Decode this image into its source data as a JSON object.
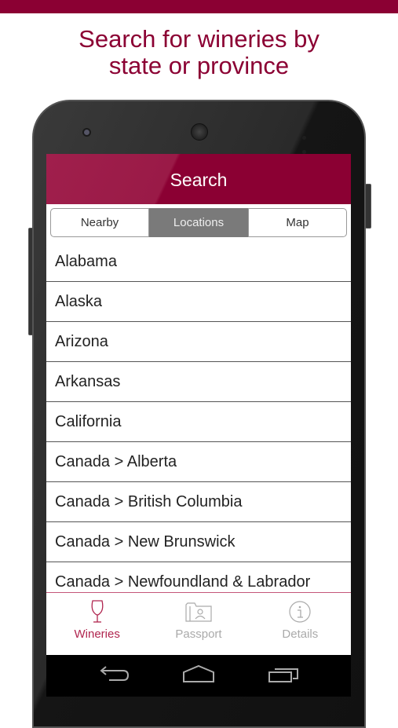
{
  "banner": {
    "headline_line1": "Search for wineries by",
    "headline_line2": "state or province"
  },
  "colors": {
    "brand": "#8b0033",
    "active_tab": "#b0254f",
    "inactive_tab": "#aaaaaa",
    "segment_active": "#7a7a7a"
  },
  "app": {
    "title": "Search",
    "segments": [
      {
        "label": "Nearby",
        "active": false
      },
      {
        "label": "Locations",
        "active": true
      },
      {
        "label": "Map",
        "active": false
      }
    ],
    "locations": [
      "Alabama",
      "Alaska",
      "Arizona",
      "Arkansas",
      "California",
      "Canada > Alberta",
      "Canada > British Columbia",
      "Canada > New Brunswick",
      "Canada > Newfoundland & Labrador"
    ],
    "tabs": [
      {
        "label": "Wineries",
        "icon": "wine-glass-icon",
        "active": true
      },
      {
        "label": "Passport",
        "icon": "passport-folder-icon",
        "active": false
      },
      {
        "label": "Details",
        "icon": "info-icon",
        "active": false
      }
    ]
  },
  "system_nav": {
    "back": "back-icon",
    "home": "home-icon",
    "recents": "recents-icon"
  }
}
